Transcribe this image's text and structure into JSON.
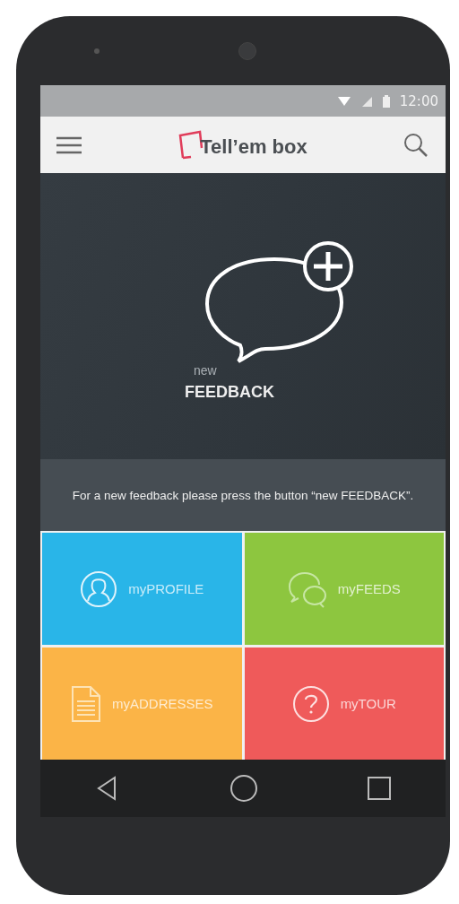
{
  "status_bar": {
    "time": "12:00"
  },
  "app_bar": {
    "title": "Tell’em box"
  },
  "hero": {
    "label_small": "new",
    "label": "FEEDBACK",
    "caption": "For a new feedback please press the button “new FEEDBACK”."
  },
  "tiles": [
    {
      "kind": "profile",
      "label": "myPROFILE",
      "color": "#29b5e8"
    },
    {
      "kind": "feeds",
      "label": "myFEEDS",
      "color": "#8dc63f"
    },
    {
      "kind": "addresses",
      "label": "myADDRESSES",
      "color": "#fbb447"
    },
    {
      "kind": "tour",
      "label": "myTOUR",
      "color": "#ef5a5a"
    }
  ]
}
